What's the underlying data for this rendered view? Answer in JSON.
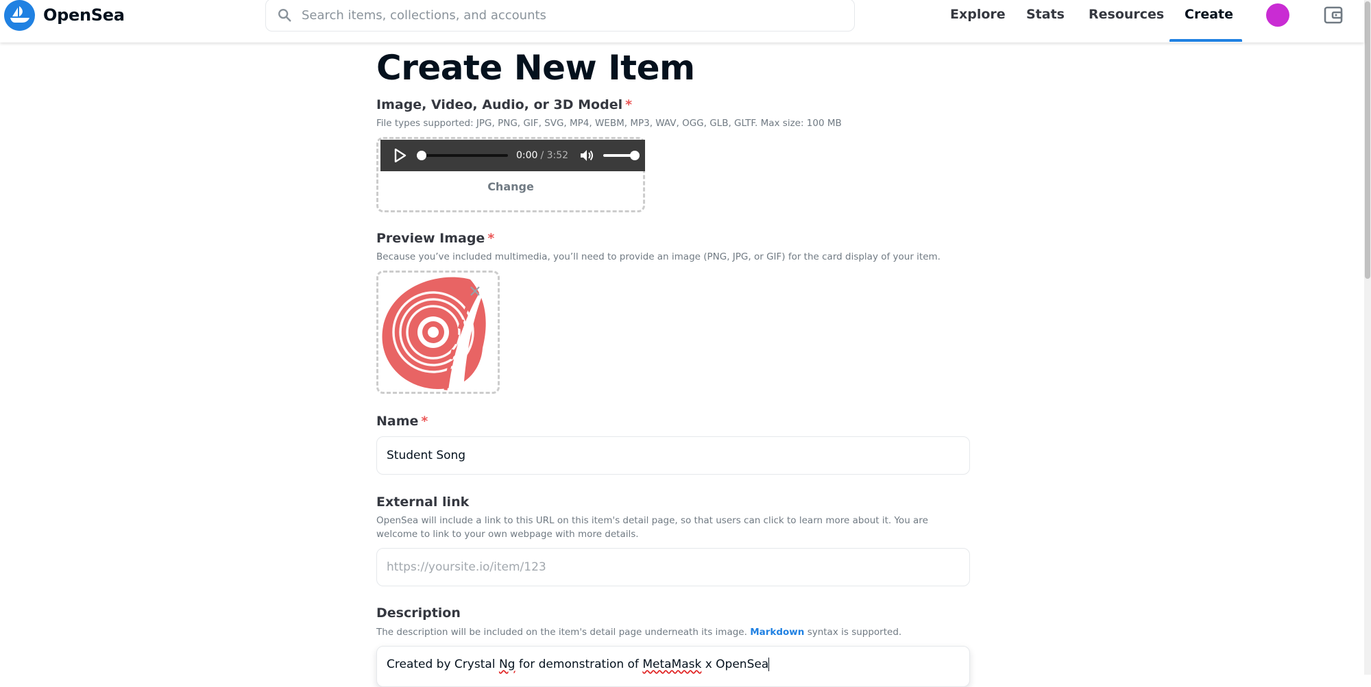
{
  "header": {
    "brand": "OpenSea",
    "search_placeholder": "Search items, collections, and accounts",
    "nav": [
      "Explore",
      "Stats",
      "Resources",
      "Create"
    ],
    "active_nav": "Create",
    "accent": "#2081e2",
    "avatar_color": "#c92cd3"
  },
  "page": {
    "title": "Create New Item",
    "media": {
      "label": "Image, Video, Audio, or 3D Model",
      "required_mark": "*",
      "hint": "File types supported: JPG, PNG, GIF, SVG, MP4, WEBM, MP3, WAV, OGG, GLB, GLTF. Max size: 100 MB",
      "player": {
        "current_time": "0:00",
        "duration": "/ 3:52",
        "progress": 0,
        "volume": 1
      },
      "change_label": "Change"
    },
    "preview": {
      "label": "Preview Image",
      "required_mark": "*",
      "hint": "Because you’ve included multimedia, you’ll need to provide an image (PNG, JPG, or GIF) for the card display of your item.",
      "image_icon": "vinyl-record-icon",
      "image_color": "#e86464"
    },
    "name": {
      "label": "Name",
      "required_mark": "*",
      "value": "Student Song"
    },
    "external_link": {
      "label": "External link",
      "hint": "OpenSea will include a link to this URL on this item's detail page, so that users can click to learn more about it. You are welcome to link to your own webpage with more details.",
      "placeholder": "https://yoursite.io/item/123"
    },
    "description": {
      "label": "Description",
      "hint_before": "The description will be included on the item's detail page underneath its image.",
      "hint_link": "Markdown",
      "hint_after": "syntax is supported.",
      "value_parts": [
        "Created by Crystal ",
        "Ng",
        " for demonstration of ",
        "MetaMask",
        " x OpenSea"
      ]
    }
  }
}
